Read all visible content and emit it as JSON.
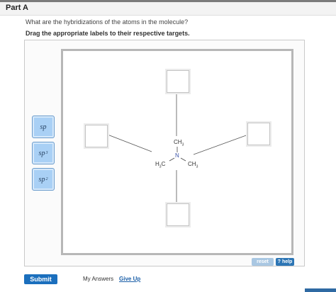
{
  "part": {
    "title": "Part A"
  },
  "question": {
    "text": "What are the hybridizations of the atoms in the molecule?"
  },
  "instruction": {
    "text": "Drag the appropriate labels to their respective targets."
  },
  "labels": [
    {
      "base": "sp",
      "sup": ""
    },
    {
      "base": "sp",
      "sup": "3"
    },
    {
      "base": "sp",
      "sup": "2"
    }
  ],
  "molecule": {
    "top": {
      "base": "CH",
      "sub": "3"
    },
    "center": "N",
    "left": {
      "base": "H",
      "sub": "3",
      "tail": "C"
    },
    "right": {
      "base": "CH",
      "sub": "3"
    }
  },
  "controls": {
    "reset_label": "reset",
    "help_icon": "?",
    "help_label": "help",
    "submit_label": "Submit",
    "my_answers_label": "My Answers",
    "give_up_label": "Give Up"
  },
  "colors": {
    "label_fill": "#a9d0f5",
    "submit": "#1b6fbd",
    "help": "#2d76b5",
    "reset": "#a9c7e2",
    "link": "#1b5fa8"
  }
}
